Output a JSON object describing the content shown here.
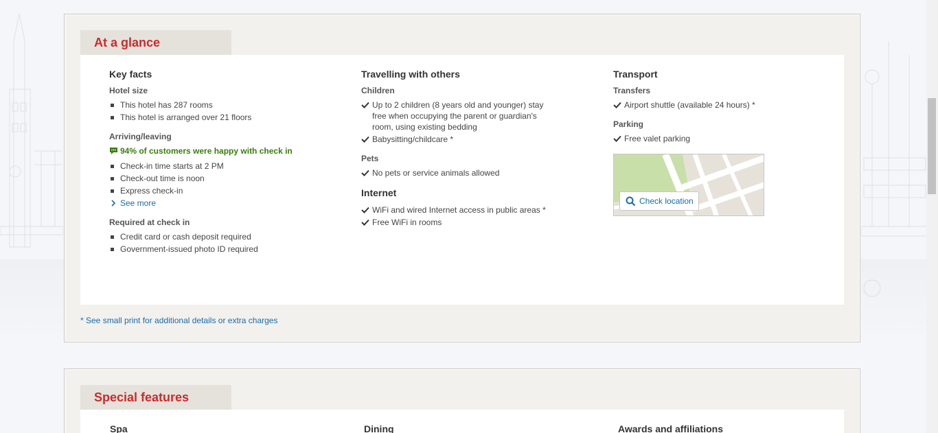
{
  "glance": {
    "title": "At a glance",
    "key_facts": {
      "title": "Key facts",
      "hotel_size": {
        "label": "Hotel size",
        "items": [
          "This hotel has 287 rooms",
          "This hotel is arranged over 21 floors"
        ]
      },
      "arriving": {
        "label": "Arriving/leaving",
        "highlight": "94% of customers were happy with check in",
        "items": [
          "Check-in time starts at 2 PM",
          "Check-out time is noon",
          "Express check-in"
        ],
        "see_more": "See more"
      },
      "required": {
        "label": "Required at check in",
        "items": [
          "Credit card or cash deposit required",
          "Government-issued photo ID required"
        ]
      }
    },
    "travelling": {
      "title": "Travelling with others",
      "children": {
        "label": "Children",
        "items": [
          "Up to 2 children (8 years old and younger) stay free when occupying the parent or guardian's room, using existing bedding",
          "Babysitting/childcare *"
        ]
      },
      "pets": {
        "label": "Pets",
        "items": [
          "No pets or service animals allowed"
        ]
      },
      "internet": {
        "title": "Internet",
        "items": [
          "WiFi and wired Internet access in public areas *",
          "Free WiFi in rooms"
        ]
      }
    },
    "transport": {
      "title": "Transport",
      "transfers": {
        "label": "Transfers",
        "items": [
          "Airport shuttle (available 24 hours) *"
        ]
      },
      "parking": {
        "label": "Parking",
        "items": [
          "Free valet parking"
        ]
      },
      "map_button": "Check location"
    },
    "footnote": "* See small print for additional details or extra charges"
  },
  "special": {
    "title": "Special features",
    "columns": [
      "Spa",
      "Dining",
      "Awards and affiliations"
    ]
  },
  "colors": {
    "accent_red": "#cc2a2a",
    "link_blue": "#1a6aa8",
    "positive_green": "#3a7d0d"
  }
}
